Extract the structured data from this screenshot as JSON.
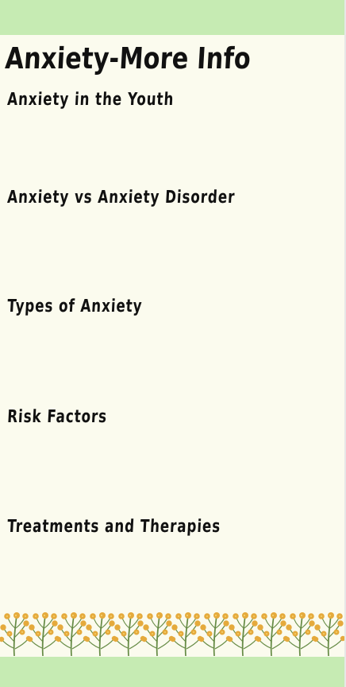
{
  "page": {
    "title": "Anxiety-More Info",
    "sections": [
      {
        "label": "Anxiety in the Youth"
      },
      {
        "label": "Anxiety vs Anxiety Disorder"
      },
      {
        "label": "Types of Anxiety"
      },
      {
        "label": "Risk Factors"
      },
      {
        "label": "Treatments and Therapies"
      }
    ]
  },
  "decoration": {
    "flower_strip_icon": "yellow-flower-sprig-icon",
    "colors": {
      "band_green": "#c6ebb3",
      "page_background": "#fbfbee",
      "flower_yellow": "#e5aa3c",
      "stem_green": "#668b45"
    }
  }
}
